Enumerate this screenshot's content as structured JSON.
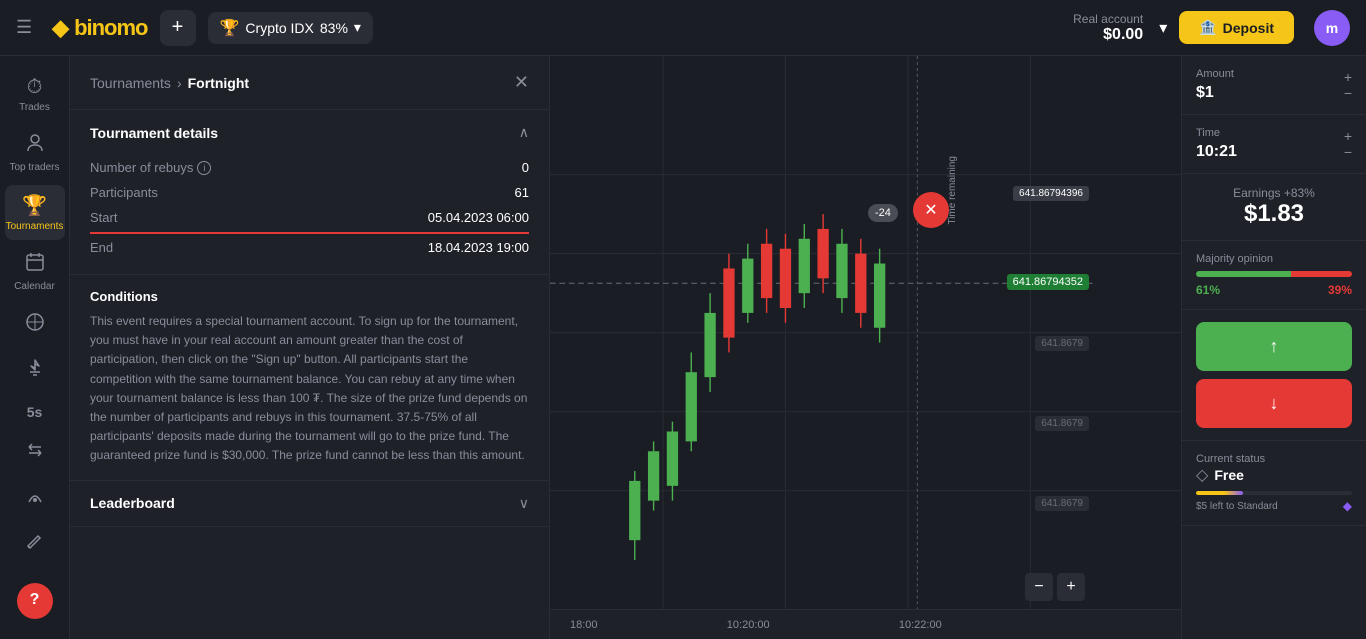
{
  "topbar": {
    "hamburger_icon": "☰",
    "logo_text": "binomo",
    "logo_icon": "◆",
    "add_icon": "+",
    "asset_icon": "🏆",
    "asset_name": "Crypto IDX",
    "asset_pct": "83%",
    "account_label": "Real account",
    "balance": "$0.00",
    "dropdown_icon": "▾",
    "deposit_label": "Deposit",
    "deposit_icon": "🏦",
    "avatar_initial": "m"
  },
  "sidebar": {
    "items": [
      {
        "id": "trades",
        "icon": "⏱",
        "label": "Trades"
      },
      {
        "id": "top-traders",
        "icon": "👤",
        "label": "Top traders"
      },
      {
        "id": "tournaments",
        "icon": "🏆",
        "label": "Tournaments",
        "active": true
      },
      {
        "id": "calendar",
        "icon": "📅",
        "label": "Calendar"
      },
      {
        "id": "indicators",
        "icon": "⊕",
        "label": ""
      },
      {
        "id": "strategies",
        "icon": "🚀",
        "label": ""
      },
      {
        "id": "5s",
        "icon": "5s",
        "label": ""
      },
      {
        "id": "trades2",
        "icon": "⇄",
        "label": ""
      },
      {
        "id": "signals",
        "icon": "📡",
        "label": ""
      },
      {
        "id": "pen",
        "icon": "✏",
        "label": ""
      }
    ],
    "help_icon": "?"
  },
  "panel": {
    "breadcrumb_parent": "Tournaments",
    "breadcrumb_chevron": "›",
    "breadcrumb_current": "Fortnight",
    "close_icon": "✕",
    "tournament_details_label": "Tournament details",
    "collapse_icon": "∧",
    "fields": {
      "rebuys_label": "Number of rebuys",
      "rebuys_value": "0",
      "participants_label": "Participants",
      "participants_value": "61",
      "start_label": "Start",
      "start_value": "05.04.2023 06:00",
      "end_label": "End",
      "end_value": "18.04.2023 19:00"
    },
    "conditions_title": "Conditions",
    "conditions_text": "This event requires a special tournament account. To sign up for the tournament, you must have in your real account an amount greater than the cost of participation, then click on the \"Sign up\" button. All participants start the competition with the same tournament balance. You can rebuy at any time when your tournament balance is less than 100 ₮. The size of the prize fund depends on the number of participants and rebuys in this tournament. 37.5-75% of all participants' deposits made during the tournament will go to the prize fund. The guaranteed prize fund is $30,000. The prize fund cannot be less than this amount.",
    "leaderboard_label": "Leaderboard",
    "leaderboard_icon": "∨"
  },
  "chart": {
    "prices": [
      "641.86794396",
      "641.86794352",
      "641.8679",
      "641.8679",
      "641.8679"
    ],
    "timer_badge": "-24",
    "time_labels": [
      "18:00",
      "10:20:00",
      "10:22:00"
    ],
    "time_remaining": "Time remaining",
    "zoom_minus": "−",
    "zoom_plus": "+"
  },
  "right_panel": {
    "amount_label": "Amount",
    "amount_value": "$1",
    "plus_icon": "+",
    "minus_icon": "−",
    "time_label": "Time",
    "time_value": "10:21",
    "earnings_label": "Earnings +83%",
    "earnings_value": "$1.83",
    "majority_label": "Majority opinion",
    "majority_green_pct": 61,
    "majority_red_pct": 39,
    "majority_green_text": "61%",
    "majority_red_text": "39%",
    "up_arrow": "↑",
    "down_arrow": "↓",
    "status_label": "Current status",
    "status_value": "Free",
    "status_icon": "◇",
    "progress_fill_pct": 30,
    "standard_text": "$5 left to Standard",
    "diamond_icon": "◆"
  }
}
